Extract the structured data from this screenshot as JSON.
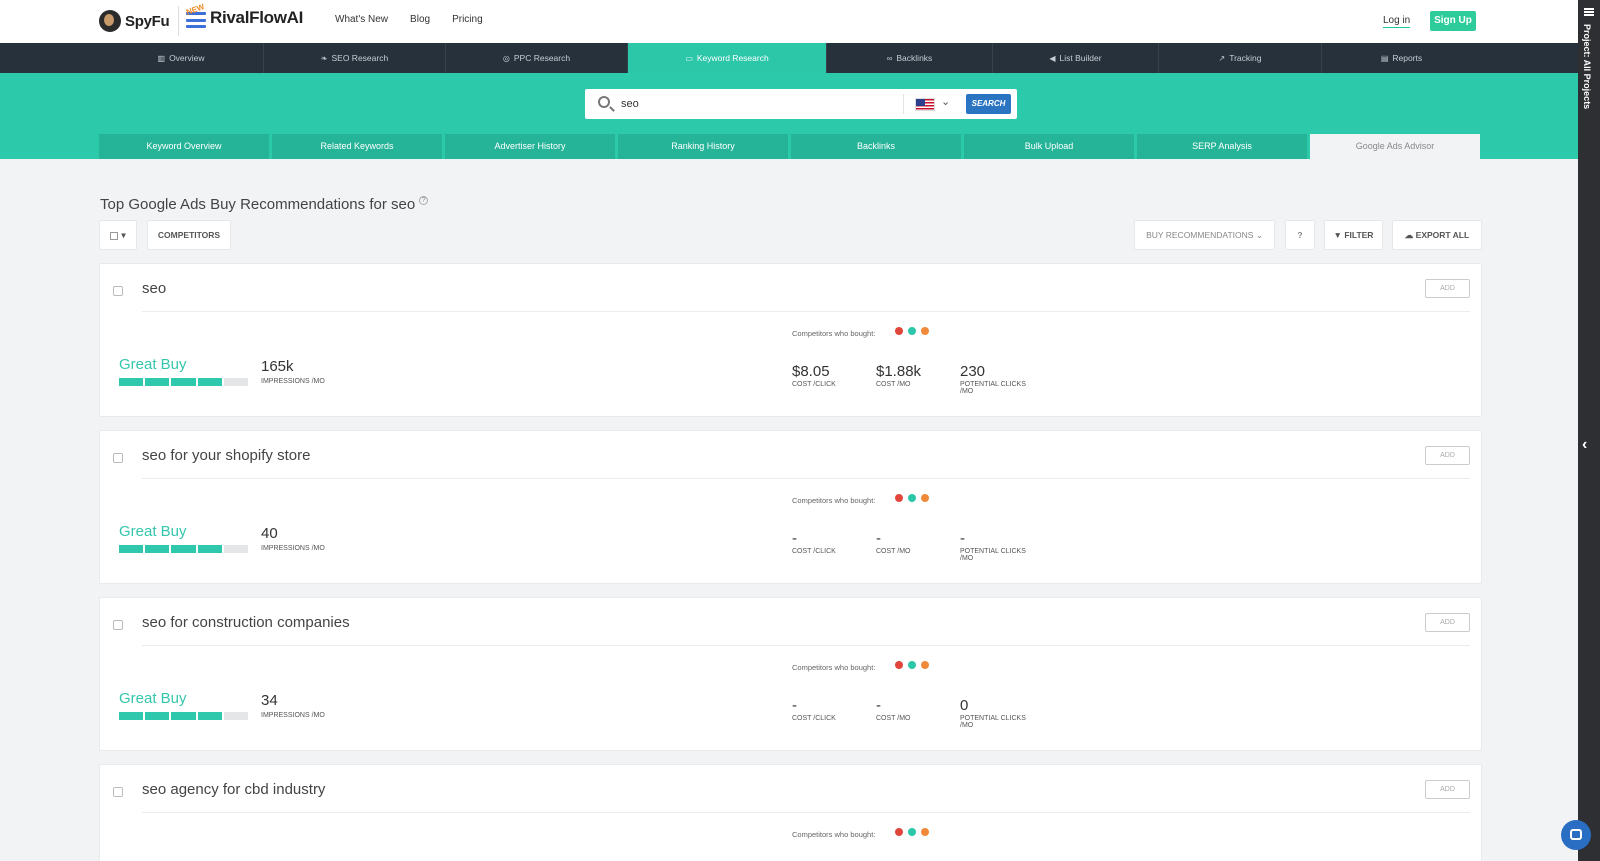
{
  "header": {
    "brand1": "SpyFu",
    "brand2_badge": "NEW",
    "brand2": "RivalFlowAI",
    "nav": [
      "What's New",
      "Blog",
      "Pricing"
    ],
    "login": "Log in",
    "signup": "Sign Up"
  },
  "rightbar": {
    "label": "Project: All Projects"
  },
  "mainnav": [
    {
      "label": "Overview",
      "icon": "bar-chart-icon"
    },
    {
      "label": "SEO Research",
      "icon": "leaf-icon"
    },
    {
      "label": "PPC Research",
      "icon": "target-icon"
    },
    {
      "label": "Keyword Research",
      "icon": "keyboard-icon",
      "active": true
    },
    {
      "label": "Backlinks",
      "icon": "link-icon"
    },
    {
      "label": "List Builder",
      "icon": "megaphone-icon"
    },
    {
      "label": "Tracking",
      "icon": "line-chart-icon"
    },
    {
      "label": "Reports",
      "icon": "document-icon"
    }
  ],
  "search": {
    "value": "seo",
    "country": "US",
    "button": "SEARCH"
  },
  "subtabs": [
    "Keyword Overview",
    "Related Keywords",
    "Advertiser History",
    "Ranking History",
    "Backlinks",
    "Bulk Upload",
    "SERP Analysis",
    "Google Ads Advisor"
  ],
  "page": {
    "title": "Top Google Ads Buy Recommendations for seo",
    "help": "?"
  },
  "controls": {
    "competitors": "COMPETITORS",
    "sort": "BUY RECOMMENDATIONS",
    "help": "?",
    "filter": "FILTER",
    "export": "EXPORT ALL"
  },
  "labels": {
    "add": "ADD",
    "competitors_who_bought": "Competitors who bought:",
    "impressions": "IMPRESSIONS /MO",
    "cost_click": "COST /CLICK",
    "cost_mo": "COST /MO",
    "potential_clicks": "POTENTIAL CLICKS /MO"
  },
  "colors": {
    "accent": "#2cc9ab",
    "dot_red": "#e0463c",
    "dot_teal": "#2cc6a8",
    "dot_orange": "#f08a3a",
    "brand_blue": "#2a74c2"
  },
  "keywords": [
    {
      "keyword": "seo",
      "rating": "Great Buy",
      "rating_level": 0.8,
      "impressions": "165k",
      "cpc": "$8.05",
      "cost_mo": "$1.88k",
      "clicks": "230"
    },
    {
      "keyword": "seo for your shopify store",
      "rating": "Great Buy",
      "rating_level": 0.8,
      "impressions": "40",
      "cpc": "-",
      "cost_mo": "-",
      "clicks": "-"
    },
    {
      "keyword": "seo for construction companies",
      "rating": "Great Buy",
      "rating_level": 0.8,
      "impressions": "34",
      "cpc": "-",
      "cost_mo": "-",
      "clicks": "0"
    },
    {
      "keyword": "seo agency for cbd industry",
      "rating": "",
      "impressions": "",
      "cpc": "",
      "cost_mo": "",
      "clicks": ""
    }
  ]
}
